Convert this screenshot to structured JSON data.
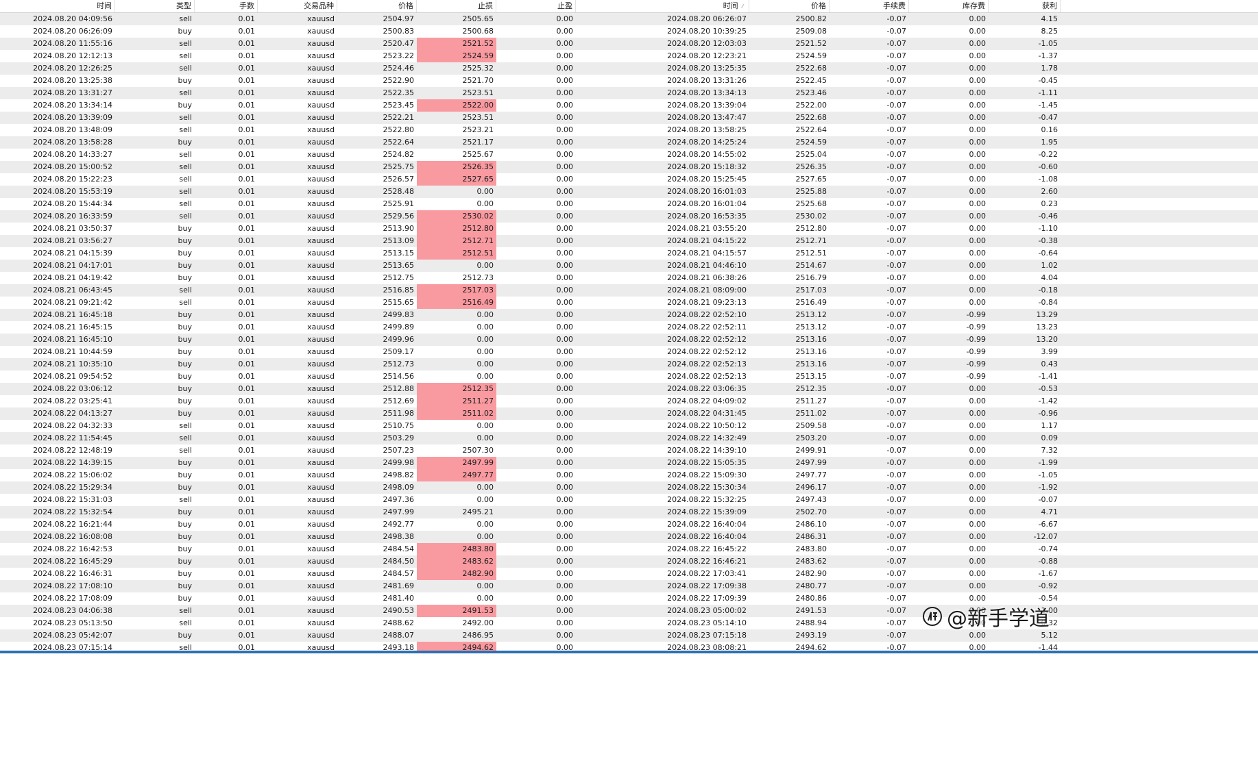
{
  "columns": [
    {
      "label": "时间",
      "width": 168
    },
    {
      "label": "类型",
      "width": 116
    },
    {
      "label": "手数",
      "width": 92
    },
    {
      "label": "交易品种",
      "width": 116
    },
    {
      "label": "价格",
      "width": 116
    },
    {
      "label": "止损",
      "width": 116
    },
    {
      "label": "止盈",
      "width": 116
    },
    {
      "label": "时间",
      "width": 253,
      "sort": "asc"
    },
    {
      "label": "价格",
      "width": 117
    },
    {
      "label": "手续费",
      "width": 116
    },
    {
      "label": "库存费",
      "width": 116
    },
    {
      "label": "获利",
      "width": 105
    }
  ],
  "highlight_color": "#f99aa0",
  "rows": [
    [
      "2024.08.20 04:09:56",
      "sell",
      "0.01",
      "xauusd",
      "2504.97",
      "2505.65",
      "0.00",
      "2024.08.20 06:26:07",
      "2500.82",
      "-0.07",
      "0.00",
      "4.15",
      0
    ],
    [
      "2024.08.20 06:26:09",
      "buy",
      "0.01",
      "xauusd",
      "2500.83",
      "2500.68",
      "0.00",
      "2024.08.20 10:39:25",
      "2509.08",
      "-0.07",
      "0.00",
      "8.25",
      0
    ],
    [
      "2024.08.20 11:55:16",
      "sell",
      "0.01",
      "xauusd",
      "2520.47",
      "2521.52",
      "0.00",
      "2024.08.20 12:03:03",
      "2521.52",
      "-0.07",
      "0.00",
      "-1.05",
      1
    ],
    [
      "2024.08.20 12:12:13",
      "sell",
      "0.01",
      "xauusd",
      "2523.22",
      "2524.59",
      "0.00",
      "2024.08.20 12:23:21",
      "2524.59",
      "-0.07",
      "0.00",
      "-1.37",
      1
    ],
    [
      "2024.08.20 12:26:25",
      "sell",
      "0.01",
      "xauusd",
      "2524.46",
      "2525.32",
      "0.00",
      "2024.08.20 13:25:35",
      "2522.68",
      "-0.07",
      "0.00",
      "1.78",
      0
    ],
    [
      "2024.08.20 13:25:38",
      "buy",
      "0.01",
      "xauusd",
      "2522.90",
      "2521.70",
      "0.00",
      "2024.08.20 13:31:26",
      "2522.45",
      "-0.07",
      "0.00",
      "-0.45",
      0
    ],
    [
      "2024.08.20 13:31:27",
      "sell",
      "0.01",
      "xauusd",
      "2522.35",
      "2523.51",
      "0.00",
      "2024.08.20 13:34:13",
      "2523.46",
      "-0.07",
      "0.00",
      "-1.11",
      0
    ],
    [
      "2024.08.20 13:34:14",
      "buy",
      "0.01",
      "xauusd",
      "2523.45",
      "2522.00",
      "0.00",
      "2024.08.20 13:39:04",
      "2522.00",
      "-0.07",
      "0.00",
      "-1.45",
      1
    ],
    [
      "2024.08.20 13:39:09",
      "sell",
      "0.01",
      "xauusd",
      "2522.21",
      "2523.51",
      "0.00",
      "2024.08.20 13:47:47",
      "2522.68",
      "-0.07",
      "0.00",
      "-0.47",
      0
    ],
    [
      "2024.08.20 13:48:09",
      "sell",
      "0.01",
      "xauusd",
      "2522.80",
      "2523.21",
      "0.00",
      "2024.08.20 13:58:25",
      "2522.64",
      "-0.07",
      "0.00",
      "0.16",
      0
    ],
    [
      "2024.08.20 13:58:28",
      "buy",
      "0.01",
      "xauusd",
      "2522.64",
      "2521.17",
      "0.00",
      "2024.08.20 14:25:24",
      "2524.59",
      "-0.07",
      "0.00",
      "1.95",
      0
    ],
    [
      "2024.08.20 14:33:27",
      "sell",
      "0.01",
      "xauusd",
      "2524.82",
      "2525.67",
      "0.00",
      "2024.08.20 14:55:02",
      "2525.04",
      "-0.07",
      "0.00",
      "-0.22",
      0
    ],
    [
      "2024.08.20 15:00:52",
      "sell",
      "0.01",
      "xauusd",
      "2525.75",
      "2526.35",
      "0.00",
      "2024.08.20 15:18:32",
      "2526.35",
      "-0.07",
      "0.00",
      "-0.60",
      1
    ],
    [
      "2024.08.20 15:22:23",
      "sell",
      "0.01",
      "xauusd",
      "2526.57",
      "2527.65",
      "0.00",
      "2024.08.20 15:25:45",
      "2527.65",
      "-0.07",
      "0.00",
      "-1.08",
      1
    ],
    [
      "2024.08.20 15:53:19",
      "sell",
      "0.01",
      "xauusd",
      "2528.48",
      "0.00",
      "0.00",
      "2024.08.20 16:01:03",
      "2525.88",
      "-0.07",
      "0.00",
      "2.60",
      0
    ],
    [
      "2024.08.20 15:44:34",
      "sell",
      "0.01",
      "xauusd",
      "2525.91",
      "0.00",
      "0.00",
      "2024.08.20 16:01:04",
      "2525.68",
      "-0.07",
      "0.00",
      "0.23",
      0
    ],
    [
      "2024.08.20 16:33:59",
      "sell",
      "0.01",
      "xauusd",
      "2529.56",
      "2530.02",
      "0.00",
      "2024.08.20 16:53:35",
      "2530.02",
      "-0.07",
      "0.00",
      "-0.46",
      1
    ],
    [
      "2024.08.21 03:50:37",
      "buy",
      "0.01",
      "xauusd",
      "2513.90",
      "2512.80",
      "0.00",
      "2024.08.21 03:55:20",
      "2512.80",
      "-0.07",
      "0.00",
      "-1.10",
      1
    ],
    [
      "2024.08.21 03:56:27",
      "buy",
      "0.01",
      "xauusd",
      "2513.09",
      "2512.71",
      "0.00",
      "2024.08.21 04:15:22",
      "2512.71",
      "-0.07",
      "0.00",
      "-0.38",
      1
    ],
    [
      "2024.08.21 04:15:39",
      "buy",
      "0.01",
      "xauusd",
      "2513.15",
      "2512.51",
      "0.00",
      "2024.08.21 04:15:57",
      "2512.51",
      "-0.07",
      "0.00",
      "-0.64",
      1
    ],
    [
      "2024.08.21 04:17:01",
      "buy",
      "0.01",
      "xauusd",
      "2513.65",
      "0.00",
      "0.00",
      "2024.08.21 04:46:10",
      "2514.67",
      "-0.07",
      "0.00",
      "1.02",
      0
    ],
    [
      "2024.08.21 04:19:42",
      "buy",
      "0.01",
      "xauusd",
      "2512.75",
      "2512.73",
      "0.00",
      "2024.08.21 06:38:26",
      "2516.79",
      "-0.07",
      "0.00",
      "4.04",
      0
    ],
    [
      "2024.08.21 06:43:45",
      "sell",
      "0.01",
      "xauusd",
      "2516.85",
      "2517.03",
      "0.00",
      "2024.08.21 08:09:00",
      "2517.03",
      "-0.07",
      "0.00",
      "-0.18",
      1
    ],
    [
      "2024.08.21 09:21:42",
      "sell",
      "0.01",
      "xauusd",
      "2515.65",
      "2516.49",
      "0.00",
      "2024.08.21 09:23:13",
      "2516.49",
      "-0.07",
      "0.00",
      "-0.84",
      1
    ],
    [
      "2024.08.21 16:45:18",
      "buy",
      "0.01",
      "xauusd",
      "2499.83",
      "0.00",
      "0.00",
      "2024.08.22 02:52:10",
      "2513.12",
      "-0.07",
      "-0.99",
      "13.29",
      0
    ],
    [
      "2024.08.21 16:45:15",
      "buy",
      "0.01",
      "xauusd",
      "2499.89",
      "0.00",
      "0.00",
      "2024.08.22 02:52:11",
      "2513.12",
      "-0.07",
      "-0.99",
      "13.23",
      0
    ],
    [
      "2024.08.21 16:45:10",
      "buy",
      "0.01",
      "xauusd",
      "2499.96",
      "0.00",
      "0.00",
      "2024.08.22 02:52:12",
      "2513.16",
      "-0.07",
      "-0.99",
      "13.20",
      0
    ],
    [
      "2024.08.21 10:44:59",
      "buy",
      "0.01",
      "xauusd",
      "2509.17",
      "0.00",
      "0.00",
      "2024.08.22 02:52:12",
      "2513.16",
      "-0.07",
      "-0.99",
      "3.99",
      0
    ],
    [
      "2024.08.21 10:35:10",
      "buy",
      "0.01",
      "xauusd",
      "2512.73",
      "0.00",
      "0.00",
      "2024.08.22 02:52:13",
      "2513.16",
      "-0.07",
      "-0.99",
      "0.43",
      0
    ],
    [
      "2024.08.21 09:54:52",
      "buy",
      "0.01",
      "xauusd",
      "2514.56",
      "0.00",
      "0.00",
      "2024.08.22 02:52:13",
      "2513.15",
      "-0.07",
      "-0.99",
      "-1.41",
      0
    ],
    [
      "2024.08.22 03:06:12",
      "buy",
      "0.01",
      "xauusd",
      "2512.88",
      "2512.35",
      "0.00",
      "2024.08.22 03:06:35",
      "2512.35",
      "-0.07",
      "0.00",
      "-0.53",
      1
    ],
    [
      "2024.08.22 03:25:41",
      "buy",
      "0.01",
      "xauusd",
      "2512.69",
      "2511.27",
      "0.00",
      "2024.08.22 04:09:02",
      "2511.27",
      "-0.07",
      "0.00",
      "-1.42",
      1
    ],
    [
      "2024.08.22 04:13:27",
      "buy",
      "0.01",
      "xauusd",
      "2511.98",
      "2511.02",
      "0.00",
      "2024.08.22 04:31:45",
      "2511.02",
      "-0.07",
      "0.00",
      "-0.96",
      1
    ],
    [
      "2024.08.22 04:32:33",
      "sell",
      "0.01",
      "xauusd",
      "2510.75",
      "0.00",
      "0.00",
      "2024.08.22 10:50:12",
      "2509.58",
      "-0.07",
      "0.00",
      "1.17",
      0
    ],
    [
      "2024.08.22 11:54:45",
      "sell",
      "0.01",
      "xauusd",
      "2503.29",
      "0.00",
      "0.00",
      "2024.08.22 14:32:49",
      "2503.20",
      "-0.07",
      "0.00",
      "0.09",
      0
    ],
    [
      "2024.08.22 12:48:19",
      "sell",
      "0.01",
      "xauusd",
      "2507.23",
      "2507.30",
      "0.00",
      "2024.08.22 14:39:10",
      "2499.91",
      "-0.07",
      "0.00",
      "7.32",
      0
    ],
    [
      "2024.08.22 14:39:15",
      "buy",
      "0.01",
      "xauusd",
      "2499.98",
      "2497.99",
      "0.00",
      "2024.08.22 15:05:35",
      "2497.99",
      "-0.07",
      "0.00",
      "-1.99",
      1
    ],
    [
      "2024.08.22 15:06:02",
      "buy",
      "0.01",
      "xauusd",
      "2498.82",
      "2497.77",
      "0.00",
      "2024.08.22 15:09:30",
      "2497.77",
      "-0.07",
      "0.00",
      "-1.05",
      1
    ],
    [
      "2024.08.22 15:29:34",
      "buy",
      "0.01",
      "xauusd",
      "2498.09",
      "0.00",
      "0.00",
      "2024.08.22 15:30:34",
      "2496.17",
      "-0.07",
      "0.00",
      "-1.92",
      0
    ],
    [
      "2024.08.22 15:31:03",
      "sell",
      "0.01",
      "xauusd",
      "2497.36",
      "0.00",
      "0.00",
      "2024.08.22 15:32:25",
      "2497.43",
      "-0.07",
      "0.00",
      "-0.07",
      0
    ],
    [
      "2024.08.22 15:32:54",
      "buy",
      "0.01",
      "xauusd",
      "2497.99",
      "2495.21",
      "0.00",
      "2024.08.22 15:39:09",
      "2502.70",
      "-0.07",
      "0.00",
      "4.71",
      0
    ],
    [
      "2024.08.22 16:21:44",
      "buy",
      "0.01",
      "xauusd",
      "2492.77",
      "0.00",
      "0.00",
      "2024.08.22 16:40:04",
      "2486.10",
      "-0.07",
      "0.00",
      "-6.67",
      0
    ],
    [
      "2024.08.22 16:08:08",
      "buy",
      "0.01",
      "xauusd",
      "2498.38",
      "0.00",
      "0.00",
      "2024.08.22 16:40:04",
      "2486.31",
      "-0.07",
      "0.00",
      "-12.07",
      0
    ],
    [
      "2024.08.22 16:42:53",
      "buy",
      "0.01",
      "xauusd",
      "2484.54",
      "2483.80",
      "0.00",
      "2024.08.22 16:45:22",
      "2483.80",
      "-0.07",
      "0.00",
      "-0.74",
      1
    ],
    [
      "2024.08.22 16:45:29",
      "buy",
      "0.01",
      "xauusd",
      "2484.50",
      "2483.62",
      "0.00",
      "2024.08.22 16:46:21",
      "2483.62",
      "-0.07",
      "0.00",
      "-0.88",
      1
    ],
    [
      "2024.08.22 16:46:31",
      "buy",
      "0.01",
      "xauusd",
      "2484.57",
      "2482.90",
      "0.00",
      "2024.08.22 17:03:41",
      "2482.90",
      "-0.07",
      "0.00",
      "-1.67",
      1
    ],
    [
      "2024.08.22 17:08:10",
      "buy",
      "0.01",
      "xauusd",
      "2481.69",
      "0.00",
      "0.00",
      "2024.08.22 17:09:38",
      "2480.77",
      "-0.07",
      "0.00",
      "-0.92",
      0
    ],
    [
      "2024.08.22 17:08:09",
      "buy",
      "0.01",
      "xauusd",
      "2481.40",
      "0.00",
      "0.00",
      "2024.08.22 17:09:39",
      "2480.86",
      "-0.07",
      "0.00",
      "-0.54",
      0
    ],
    [
      "2024.08.23 04:06:38",
      "sell",
      "0.01",
      "xauusd",
      "2490.53",
      "2491.53",
      "0.00",
      "2024.08.23 05:00:02",
      "2491.53",
      "-0.07",
      "0.00",
      "-1.00",
      1
    ],
    [
      "2024.08.23 05:13:50",
      "sell",
      "0.01",
      "xauusd",
      "2488.62",
      "2492.00",
      "0.00",
      "2024.08.23 05:14:10",
      "2488.94",
      "-0.07",
      "0.00",
      "-0.32",
      0
    ],
    [
      "2024.08.23 05:42:07",
      "buy",
      "0.01",
      "xauusd",
      "2488.07",
      "2486.95",
      "0.00",
      "2024.08.23 07:15:18",
      "2493.19",
      "-0.07",
      "0.00",
      "5.12",
      0
    ],
    [
      "2024.08.23 07:15:14",
      "sell",
      "0.01",
      "xauusd",
      "2493.18",
      "2494.62",
      "0.00",
      "2024.08.23 08:08:21",
      "2494.62",
      "-0.07",
      "0.00",
      "-1.44",
      1
    ]
  ],
  "watermark": {
    "text": "@新手学道",
    "icon": "zhihu-logo-icon"
  }
}
